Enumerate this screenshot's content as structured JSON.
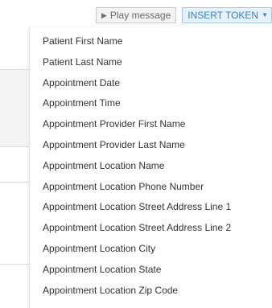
{
  "toolbar": {
    "play_label": "Play message",
    "play_icon": "play-icon",
    "token_label": "INSERT TOKEN",
    "token_icon": "caret-down-icon"
  },
  "colors": {
    "token_accent": "#3a7fc4",
    "token_bg": "#e6f1fa",
    "menu_text": "#333333"
  },
  "menu": {
    "items": [
      "Patient First Name",
      "Patient Last Name",
      "Appointment Date",
      "Appointment Time",
      "Appointment Provider First Name",
      "Appointment Provider Last Name",
      "Appointment Location Name",
      "Appointment Location Phone Number",
      "Appointment Location Street Address Line 1",
      "Appointment Location Street Address Line 2",
      "Appointment Location City",
      "Appointment Location State",
      "Appointment Location Zip Code"
    ]
  }
}
